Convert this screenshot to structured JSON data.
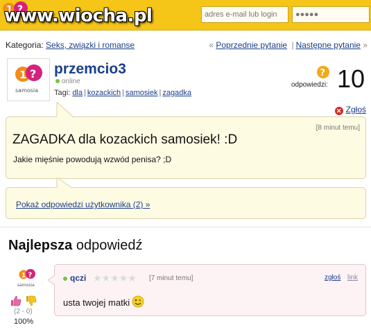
{
  "header": {
    "watermark": "www.wiocha.pl",
    "email_placeholder": "adres e-mail lub login",
    "password_value": "●●●●●"
  },
  "category": {
    "label": "Kategoria:",
    "link": "Seks, związki i romanse"
  },
  "nav": {
    "prev_arrow": "«",
    "prev": "Poprzednie pytanie",
    "separator": "|",
    "next": "Następne pytanie",
    "next_arrow": "»"
  },
  "asker": {
    "avatar_caption": "samosia",
    "username": "przemcio3",
    "status": "online",
    "tags_label": "Tagi:",
    "tags": [
      "dla",
      "kozackich",
      "samosiek",
      "zagadka"
    ]
  },
  "answers": {
    "label": "odpowiedzi:",
    "count": "10"
  },
  "report_label": "Zgłoś",
  "question": {
    "time": "[8 minut temu]",
    "title": "ZAGADKA dla kozackich samosiek! :D",
    "body": "Jakie mięśnie powodują wzwód penisa? ;D"
  },
  "user_answers_link": "Pokaż odpowiedzi użytkownika (2) »",
  "best": {
    "bold": "Najlepsza",
    "rest": " odpowiedź"
  },
  "answer": {
    "avatar_caption": "samosia",
    "username": "qczi",
    "stars": "★★★★★",
    "rating": 0,
    "time": "[7 minut temu]",
    "report": "zgłoś",
    "link": "link",
    "body": "usta twojej matki",
    "votes": "(2 - 0)",
    "percent": "100%"
  },
  "colors": {
    "topbar": "#f5c518",
    "link": "#1a3e8c",
    "question_bg": "#fefbe3",
    "answer_bg": "#fdf3f5",
    "online": "#7cc03c"
  }
}
